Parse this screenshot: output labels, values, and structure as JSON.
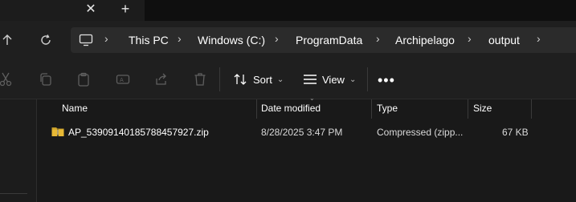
{
  "tab_bar": {
    "close_icon": "close-icon",
    "new_tab_icon": "plus-icon"
  },
  "nav": {
    "up_icon": "arrow-up-icon",
    "refresh_icon": "refresh-icon",
    "breadcrumb": [
      "This PC",
      "Windows (C:)",
      "ProgramData",
      "Archipelago",
      "output"
    ]
  },
  "toolbar": {
    "icons": [
      "cut-icon",
      "copy-icon",
      "paste-icon",
      "rename-icon",
      "share-icon",
      "delete-icon"
    ],
    "sort_label": "Sort",
    "view_label": "View",
    "more_label": "•••"
  },
  "columns": {
    "name": "Name",
    "date_modified": "Date modified",
    "type": "Type",
    "size": "Size"
  },
  "files": [
    {
      "name": "AP_53909140185788457927.zip",
      "date_modified": "8/28/2025 3:47 PM",
      "type": "Compressed (zipp...",
      "size": "67 KB",
      "icon": "zip-folder-icon"
    }
  ],
  "colors": {
    "background": "#191919",
    "toolbar": "#1f1f1f",
    "address_bar": "#2b2b2b",
    "text": "#ffffff",
    "zip_folder": "#e8b935"
  }
}
